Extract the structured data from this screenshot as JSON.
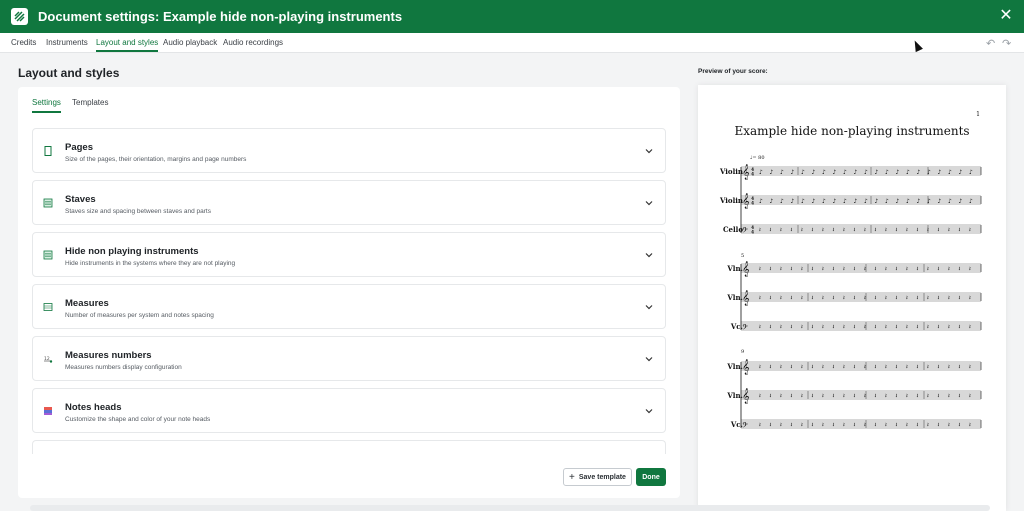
{
  "window": {
    "title": "Document settings: Example hide non-playing instruments",
    "close_icon": "close-icon"
  },
  "tabs": [
    {
      "label": "Credits"
    },
    {
      "label": "Instruments"
    },
    {
      "label": "Layout and styles",
      "active": true
    },
    {
      "label": "Audio playback"
    },
    {
      "label": "Audio recordings"
    }
  ],
  "history": {
    "undo_icon": "undo-icon",
    "redo_icon": "redo-icon"
  },
  "main": {
    "heading": "Layout and styles",
    "subtabs": [
      {
        "label": "Settings",
        "active": true
      },
      {
        "label": "Templates"
      }
    ],
    "sections": [
      {
        "title": "Pages",
        "desc": "Size of the pages, their orientation, margins and page numbers",
        "icon": "page-icon"
      },
      {
        "title": "Staves",
        "desc": "Staves size and spacing between staves and parts",
        "icon": "staves-icon"
      },
      {
        "title": "Hide non playing instruments",
        "desc": "Hide instruments in the systems where they are not playing",
        "icon": "staves-icon"
      },
      {
        "title": "Measures",
        "desc": "Number of measures per system and notes spacing",
        "icon": "measures-icon"
      },
      {
        "title": "Measures numbers",
        "desc": "Measures numbers display configuration",
        "icon": "measure-numbers-icon"
      },
      {
        "title": "Notes heads",
        "desc": "Customize the shape and color of your note heads",
        "icon": "note-heads-icon"
      }
    ],
    "save_template": "Save template",
    "done": "Done"
  },
  "preview": {
    "label": "Preview of your score:",
    "title": "Example hide non-playing instruments",
    "page_number": "1",
    "tempo": "♩= 80",
    "systems": [
      {
        "number": "",
        "instruments": [
          "Violin",
          "Violin",
          "Cello"
        ]
      },
      {
        "number": "5",
        "instruments": [
          "Vln.",
          "Vln.",
          "Vc."
        ]
      },
      {
        "number": "9",
        "instruments": [
          "Vln.",
          "Vln.",
          "Vc."
        ]
      }
    ]
  },
  "colors": {
    "brand": "#10773f"
  }
}
